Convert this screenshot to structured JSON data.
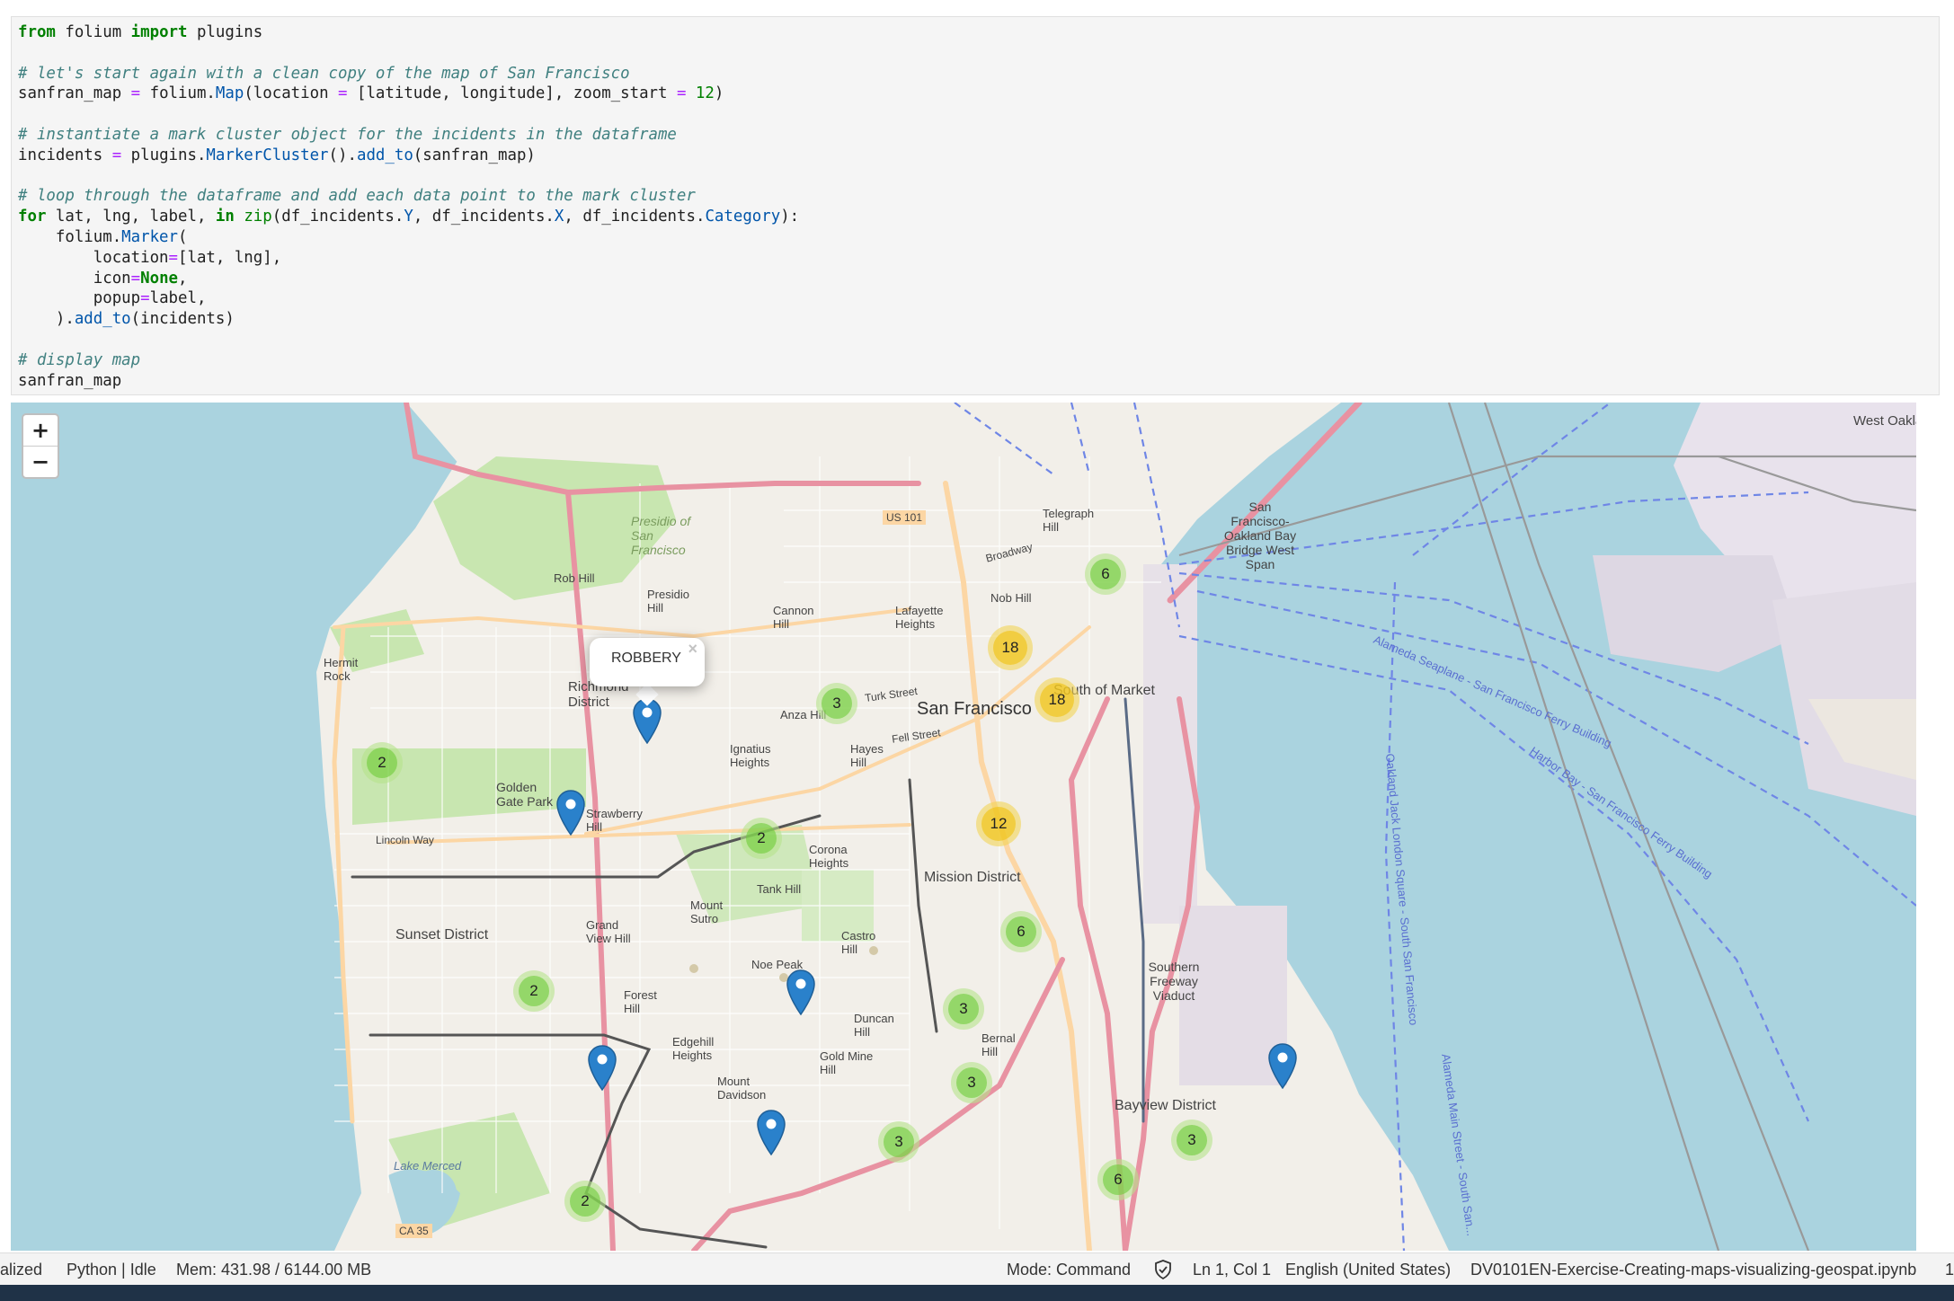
{
  "code_cell": {
    "lines": [
      [
        {
          "t": "kw",
          "s": "from"
        },
        {
          "t": "tx",
          "s": " folium "
        },
        {
          "t": "kw",
          "s": "import"
        },
        {
          "t": "tx",
          "s": " plugins"
        }
      ],
      [],
      [
        {
          "t": "cm",
          "s": "# let's start again with a clean copy of the map of San Francisco"
        }
      ],
      [
        {
          "t": "tx",
          "s": "sanfran_map "
        },
        {
          "t": "op",
          "s": "="
        },
        {
          "t": "tx",
          "s": " folium."
        },
        {
          "t": "at",
          "s": "Map"
        },
        {
          "t": "tx",
          "s": "(location "
        },
        {
          "t": "op",
          "s": "="
        },
        {
          "t": "tx",
          "s": " [latitude, longitude], zoom_start "
        },
        {
          "t": "op",
          "s": "="
        },
        {
          "t": "tx",
          "s": " "
        },
        {
          "t": "nm",
          "s": "12"
        },
        {
          "t": "tx",
          "s": ")"
        }
      ],
      [],
      [
        {
          "t": "cm",
          "s": "# instantiate a mark cluster object for the incidents in the dataframe"
        }
      ],
      [
        {
          "t": "tx",
          "s": "incidents "
        },
        {
          "t": "op",
          "s": "="
        },
        {
          "t": "tx",
          "s": " plugins."
        },
        {
          "t": "at",
          "s": "MarkerCluster"
        },
        {
          "t": "tx",
          "s": "()."
        },
        {
          "t": "at",
          "s": "add_to"
        },
        {
          "t": "tx",
          "s": "(sanfran_map)"
        }
      ],
      [],
      [
        {
          "t": "cm",
          "s": "# loop through the dataframe and add each data point to the mark cluster"
        }
      ],
      [
        {
          "t": "kw",
          "s": "for"
        },
        {
          "t": "tx",
          "s": " lat, lng, label, "
        },
        {
          "t": "kw",
          "s": "in"
        },
        {
          "t": "tx",
          "s": " "
        },
        {
          "t": "nm",
          "s": "zip"
        },
        {
          "t": "tx",
          "s": "(df_incidents."
        },
        {
          "t": "at",
          "s": "Y"
        },
        {
          "t": "tx",
          "s": ", df_incidents."
        },
        {
          "t": "at",
          "s": "X"
        },
        {
          "t": "tx",
          "s": ", df_incidents."
        },
        {
          "t": "at",
          "s": "Category"
        },
        {
          "t": "tx",
          "s": "):"
        }
      ],
      [
        {
          "t": "tx",
          "s": "    folium."
        },
        {
          "t": "at",
          "s": "Marker"
        },
        {
          "t": "tx",
          "s": "("
        }
      ],
      [
        {
          "t": "tx",
          "s": "        location"
        },
        {
          "t": "op",
          "s": "="
        },
        {
          "t": "tx",
          "s": "[lat, lng],"
        }
      ],
      [
        {
          "t": "tx",
          "s": "        icon"
        },
        {
          "t": "op",
          "s": "="
        },
        {
          "t": "kw",
          "s": "None"
        },
        {
          "t": "tx",
          "s": ","
        }
      ],
      [
        {
          "t": "tx",
          "s": "        popup"
        },
        {
          "t": "op",
          "s": "="
        },
        {
          "t": "tx",
          "s": "label,"
        }
      ],
      [
        {
          "t": "tx",
          "s": "    )."
        },
        {
          "t": "at",
          "s": "add_to"
        },
        {
          "t": "tx",
          "s": "(incidents)"
        }
      ],
      [],
      [
        {
          "t": "cm",
          "s": "# display map"
        }
      ],
      [
        {
          "t": "tx",
          "s": "sanfran_map"
        }
      ]
    ]
  },
  "map": {
    "zoom_in_label": "+",
    "zoom_out_label": "−",
    "popup_text": "ROBBERY",
    "popup_close": "×",
    "clusters": [
      {
        "count": "6",
        "color": "green"
      },
      {
        "count": "18",
        "color": "yellow"
      },
      {
        "count": "18",
        "color": "yellow"
      },
      {
        "count": "3",
        "color": "green"
      },
      {
        "count": "2",
        "color": "green"
      },
      {
        "count": "2",
        "color": "green"
      },
      {
        "count": "12",
        "color": "yellow"
      },
      {
        "count": "6",
        "color": "green"
      },
      {
        "count": "2",
        "color": "green"
      },
      {
        "count": "3",
        "color": "green"
      },
      {
        "count": "3",
        "color": "green"
      },
      {
        "count": "3",
        "color": "green"
      },
      {
        "count": "3",
        "color": "green"
      },
      {
        "count": "6",
        "color": "green"
      },
      {
        "count": "2",
        "color": "green"
      }
    ],
    "labels": {
      "san_francisco": "San Francisco",
      "south_of_market": "South of Market",
      "mission_district": "Mission District",
      "sunset_district": "Sunset District",
      "bayview_district": "Bayview District",
      "richmond_district": "Richmond District",
      "golden_gate_park": "Golden Gate Park",
      "presidio": "Presidio of San Francisco",
      "bay_bridge": "San Francisco-Oakland Bay Bridge West Span",
      "west_oakland": "West Oakland",
      "us101": "US 101",
      "turk_street": "Turk Street",
      "fell_street": "Fell Street",
      "lincoln_way": "Lincoln Way",
      "broadway": "Broadway",
      "telegraph_hill": "Telegraph Hill",
      "nob_hill": "Nob Hill",
      "lafayette_heights": "Lafayette Heights",
      "cannon_hill": "Cannon Hill",
      "rob_hill": "Rob Hill",
      "presidio_hill": "Presidio Hill",
      "southern_freeway": "Southern Freeway Viaduct",
      "lake_merced": "Lake Merced",
      "ca35": "CA 35",
      "twin_peaks": "Noe Peak",
      "mount_sutro": "Mount Sutro",
      "mount_davidson": "Mount Davidson",
      "corona_heights": "Corona Heights",
      "grand_view_hill": "Grand View Hill",
      "forest_hill": "Forest Hill",
      "castro_hill": "Castro Hill",
      "bernal_hill": "Bernal Hill",
      "duncan_hill": "Duncan Hill",
      "gold_mine_hill": "Gold Mine Hill",
      "edgehill_heights": "Edgehill Heights",
      "tank_hill": "Tank Hill",
      "hayes_hill": "Hayes Hill",
      "ignatius_heights": "Ignatius Heights",
      "anza_hill": "Anza Hill",
      "strawberry_hill": "Strawberry Hill",
      "hermit_rock": "Hermit Rock",
      "ferry_building": "Harbor Bay - San Francisco Ferry Building",
      "alameda_seaplane": "Alameda Seaplane - San Francisco Ferry Building",
      "oakland_jack": "Oakland Jack London Square - South San Francisco",
      "alameda_main": "Alameda Main Street - South San..."
    }
  },
  "status_bar": {
    "kernel_state": "alized",
    "kernel": "Python | Idle",
    "memory": "Mem: 431.98 / 6144.00 MB",
    "mode": "Mode: Command",
    "cursor": "Ln 1, Col 1",
    "language": "English (United States)",
    "filename": "DV0101EN-Exercise-Creating-maps-visualizing-geospat.ipynb",
    "extra": "1"
  },
  "colors": {
    "water": "#aad3df",
    "land": "#f2efe9",
    "park": "#c8e6b0",
    "motorway": "#e892a2",
    "primary": "#fcd6a4",
    "marker_blue": "#2a81cb",
    "cluster_green": "#6ecc39",
    "cluster_yellow": "#f0c20c"
  }
}
